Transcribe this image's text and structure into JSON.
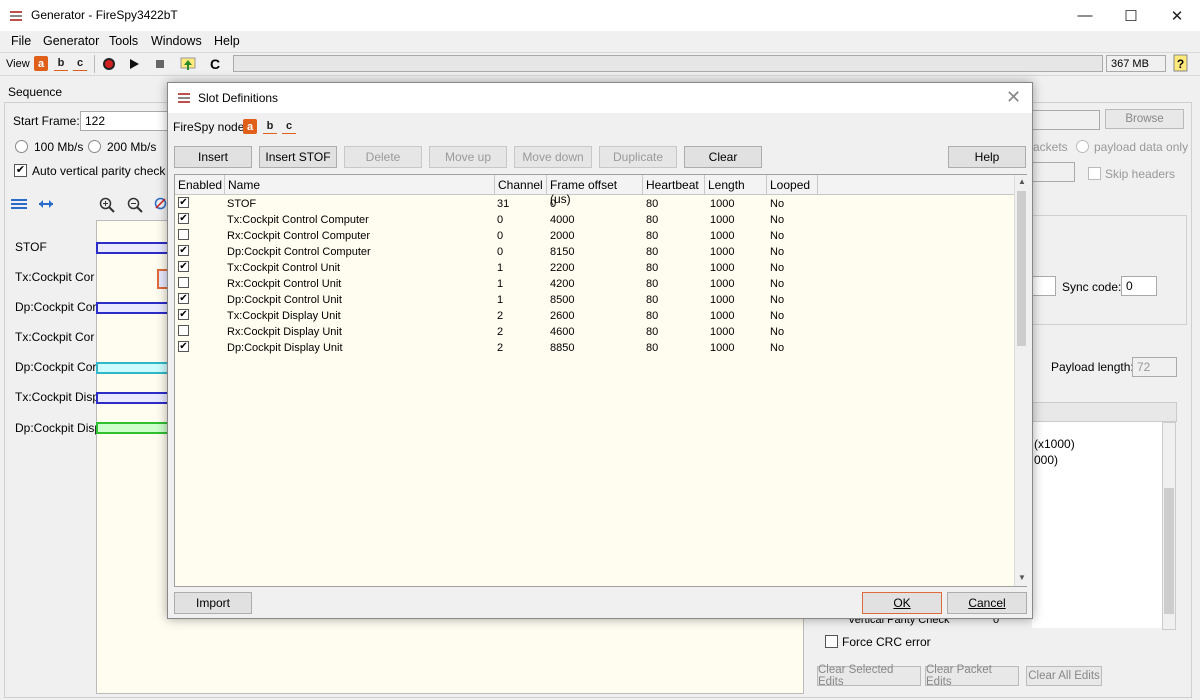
{
  "window": {
    "title": "Generator - FireSpy3422bT",
    "minimize": "—",
    "maximize": "☐",
    "close": "✕"
  },
  "menu": [
    "File",
    "Generator",
    "Tools",
    "Windows",
    "Help"
  ],
  "toolbar": {
    "view_label": "View",
    "nodes": [
      "a",
      "b",
      "c"
    ],
    "c_label": "C",
    "memory": "367 MB"
  },
  "sequence": {
    "header": "Sequence",
    "start_frame_label": "Start Frame:",
    "start_frame_value": "122",
    "rate_100": "100 Mb/s",
    "rate_200": "200 Mb/s",
    "auto_parity": "Auto vertical parity check",
    "browse": "Browse",
    "packets": "ackets",
    "payload_only": "payload data only",
    "skip_headers": "Skip headers",
    "sync_code_label": "Sync code:",
    "sync_code_value": "0",
    "payload_length_label": "Payload length:",
    "payload_length_value": "72",
    "x1000": "(x1000)",
    "val_000": "000)",
    "vertical_parity": "Vertical Parity Check",
    "vertical_parity_value": "0",
    "force_crc": "Force CRC error",
    "clear_selected": "Clear Selected Edits",
    "clear_packet": "Clear Packet Edits",
    "clear_all": "Clear All Edits"
  },
  "slot_labels": [
    "STOF",
    "Tx:Cockpit Cor",
    "Dp:Cockpit Cor",
    "Tx:Cockpit Cor",
    "Dp:Cockpit Cor",
    "Tx:Cockpit Disp",
    "Dp:Cockpit Disp"
  ],
  "dialog": {
    "title": "Slot Definitions",
    "firespy_node_label": "FireSpy node",
    "nodes": [
      "a",
      "b",
      "c"
    ],
    "buttons": {
      "insert": "Insert",
      "insert_stof": "Insert STOF",
      "delete": "Delete",
      "move_up": "Move up",
      "move_down": "Move down",
      "duplicate": "Duplicate",
      "clear": "Clear",
      "help": "Help",
      "import": "Import",
      "ok": "OK",
      "cancel": "Cancel"
    },
    "columns": [
      "Enabled",
      "Name",
      "Channel",
      "Frame offset (us)",
      "Heartbeat",
      "Length",
      "Looped"
    ],
    "rows": [
      {
        "enabled": true,
        "name": "STOF",
        "channel": "31",
        "offset": "0",
        "heartbeat": "80",
        "length": "1000",
        "looped": "No"
      },
      {
        "enabled": true,
        "name": "Tx:Cockpit Control Computer",
        "channel": "0",
        "offset": "4000",
        "heartbeat": "80",
        "length": "1000",
        "looped": "No"
      },
      {
        "enabled": false,
        "name": "Rx:Cockpit Control Computer",
        "channel": "0",
        "offset": "2000",
        "heartbeat": "80",
        "length": "1000",
        "looped": "No"
      },
      {
        "enabled": true,
        "name": "Dp:Cockpit Control Computer",
        "channel": "0",
        "offset": "8150",
        "heartbeat": "80",
        "length": "1000",
        "looped": "No"
      },
      {
        "enabled": true,
        "name": "Tx:Cockpit Control Unit",
        "channel": "1",
        "offset": "2200",
        "heartbeat": "80",
        "length": "1000",
        "looped": "No"
      },
      {
        "enabled": false,
        "name": "Rx:Cockpit Control Unit",
        "channel": "1",
        "offset": "4200",
        "heartbeat": "80",
        "length": "1000",
        "looped": "No"
      },
      {
        "enabled": true,
        "name": "Dp:Cockpit Control Unit",
        "channel": "1",
        "offset": "8500",
        "heartbeat": "80",
        "length": "1000",
        "looped": "No"
      },
      {
        "enabled": true,
        "name": "Tx:Cockpit Display Unit",
        "channel": "2",
        "offset": "2600",
        "heartbeat": "80",
        "length": "1000",
        "looped": "No"
      },
      {
        "enabled": false,
        "name": "Rx:Cockpit Display Unit",
        "channel": "2",
        "offset": "4600",
        "heartbeat": "80",
        "length": "1000",
        "looped": "No"
      },
      {
        "enabled": true,
        "name": "Dp:Cockpit Display Unit",
        "channel": "2",
        "offset": "8850",
        "heartbeat": "80",
        "length": "1000",
        "looped": "No"
      }
    ]
  },
  "colors": {
    "accent": "#e0601a",
    "table_bg": "#fffdf0",
    "slot_border": "#2c2cc8"
  }
}
